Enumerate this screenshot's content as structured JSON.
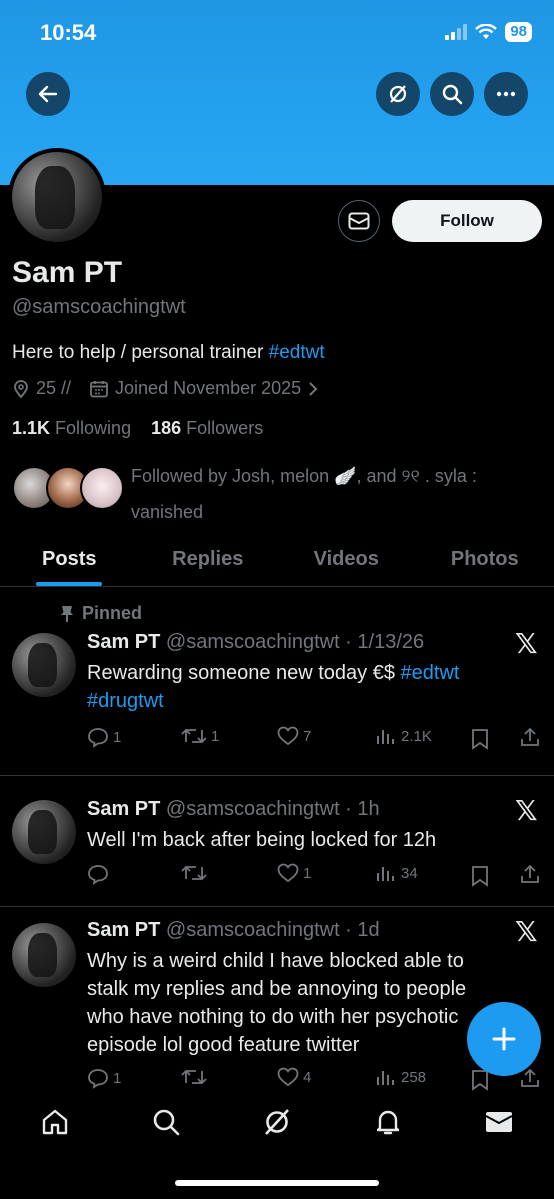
{
  "status_bar": {
    "time": "10:54",
    "battery": "98"
  },
  "profile": {
    "name": "Sam PT",
    "handle": "@samscoachingtwt",
    "bio_text": "Here to help / personal trainer ",
    "bio_tag": "#edtwt",
    "location": "25 //",
    "joined": "Joined November 2025",
    "following_count": "1.1K",
    "following_label": "Following",
    "followers_count": "186",
    "followers_label": "Followers",
    "followed_by": "Followed by Josh, melon 🪽, and ୨୧ . syla : vanished",
    "follow_label": "Follow"
  },
  "tabs": [
    {
      "label": "Posts",
      "active": true
    },
    {
      "label": "Replies"
    },
    {
      "label": "Videos"
    },
    {
      "label": "Photos"
    }
  ],
  "posts": [
    {
      "pinned_label": "Pinned",
      "name": "Sam PT",
      "meta": "@samscoachingtwt · 1/13/26",
      "text": "Rewarding someone new today €$ ",
      "tags": "#edtwt #drugtwt",
      "replies": "1",
      "reposts": "1",
      "likes": "7",
      "views": "2.1K"
    },
    {
      "name": "Sam PT",
      "meta": "@samscoachingtwt · 1h",
      "text": "Well I'm back after being locked for 12h",
      "replies": "",
      "reposts": "",
      "likes": "1",
      "views": "34"
    },
    {
      "name": "Sam PT",
      "meta": "@samscoachingtwt · 1d",
      "text": "Why is a weird child I have blocked able to stalk my replies and be annoying to people who have nothing to do with her psychotic episode lol good feature twitter",
      "replies": "1",
      "reposts": "",
      "likes": "4",
      "views": "258"
    }
  ],
  "colors": {
    "accent": "#1d9bf0",
    "banner": "#23a0ee",
    "muted": "#71767b"
  }
}
